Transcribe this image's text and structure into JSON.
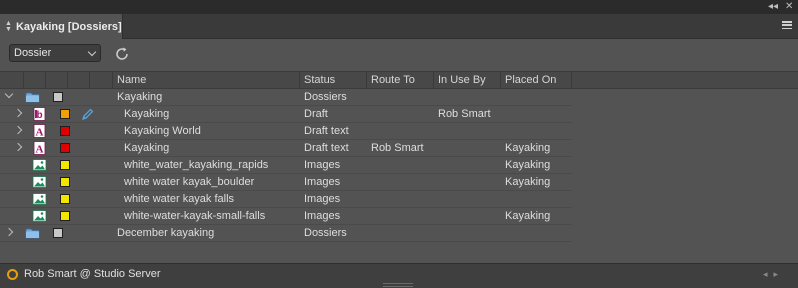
{
  "window": {
    "collapse_glyph": "◂◂",
    "close_glyph": "✕"
  },
  "tab": {
    "title": "Kayaking [Dossiers]"
  },
  "toolbar": {
    "view_select_value": "Dossier",
    "refresh_icon": "refresh-icon"
  },
  "columns": {
    "name": "Name",
    "status": "Status",
    "route_to": "Route To",
    "in_use_by": "In Use By",
    "placed_on": "Placed On"
  },
  "rows": [
    {
      "level": 0,
      "expander": "down",
      "type": "folder",
      "color": "#c8c8c8",
      "edit": false,
      "name": "Kayaking",
      "status": "Dossiers",
      "route_to": "",
      "in_use_by": "",
      "placed_on": ""
    },
    {
      "level": 1,
      "expander": "right",
      "type": "indesign",
      "color": "#f0a000",
      "edit": true,
      "name": "Kayaking",
      "status": "Draft",
      "route_to": "",
      "in_use_by": "Rob Smart",
      "placed_on": ""
    },
    {
      "level": 1,
      "expander": "right",
      "type": "article",
      "color": "#e00000",
      "edit": false,
      "name": "Kayaking World",
      "status": "Draft text",
      "route_to": "",
      "in_use_by": "",
      "placed_on": ""
    },
    {
      "level": 1,
      "expander": "right",
      "type": "article",
      "color": "#e00000",
      "edit": false,
      "name": "Kayaking",
      "status": "Draft text",
      "route_to": "Rob Smart",
      "in_use_by": "",
      "placed_on": "Kayaking"
    },
    {
      "level": 1,
      "expander": "none",
      "type": "image",
      "color": "#f2e600",
      "edit": false,
      "name": "white_water_kayaking_rapids",
      "status": "Images",
      "route_to": "",
      "in_use_by": "",
      "placed_on": "Kayaking"
    },
    {
      "level": 1,
      "expander": "none",
      "type": "image",
      "color": "#f2e600",
      "edit": false,
      "name": "white water kayak_boulder",
      "status": "Images",
      "route_to": "",
      "in_use_by": "",
      "placed_on": "Kayaking"
    },
    {
      "level": 1,
      "expander": "none",
      "type": "image",
      "color": "#f2e600",
      "edit": false,
      "name": "white water kayak falls",
      "status": "Images",
      "route_to": "",
      "in_use_by": "",
      "placed_on": ""
    },
    {
      "level": 1,
      "expander": "none",
      "type": "image",
      "color": "#f2e600",
      "edit": false,
      "name": "white-water-kayak-small-falls",
      "status": "Images",
      "route_to": "",
      "in_use_by": "",
      "placed_on": "Kayaking"
    },
    {
      "level": 0,
      "expander": "right",
      "type": "folder",
      "color": "#c8c8c8",
      "edit": false,
      "name": "December kayaking",
      "status": "Dossiers",
      "route_to": "",
      "in_use_by": "",
      "placed_on": ""
    }
  ],
  "status": {
    "connection": "Rob Smart @ Studio Server",
    "connection_color": "#e8a000"
  }
}
